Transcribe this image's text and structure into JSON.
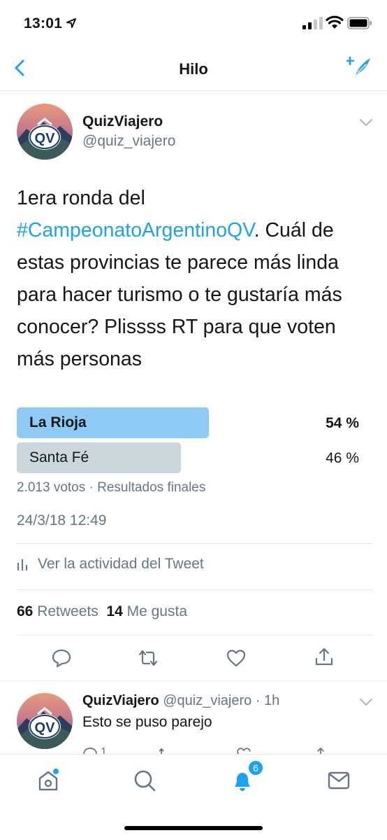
{
  "status_bar": {
    "time": "13:01"
  },
  "nav": {
    "title": "Hilo"
  },
  "tweet": {
    "author_name": "QuizViajero",
    "author_handle": "@quiz_viajero",
    "avatar_text": "QV",
    "text_before": "1era ronda del ",
    "hashtag": "#CampeonatoArgentinoQV",
    "text_after": ". Cuál de estas provincias te parece más linda para hacer turismo o te gustaría más conocer? Plissss RT para que voten más personas",
    "poll": {
      "options": [
        {
          "label": "La Rioja",
          "percent_label": "54 %",
          "percent": 54,
          "winner": true,
          "color": "#8fcaf5"
        },
        {
          "label": "Santa Fé",
          "percent_label": "46 %",
          "percent": 46,
          "winner": false,
          "color": "#ccd6dd"
        }
      ],
      "meta": "2.013 votos · Resultados finales"
    },
    "date": "24/3/18 12:49",
    "activity_label": "Ver la actividad del Tweet",
    "stats": {
      "retweets_count": "66",
      "retweets_label": "Retweets",
      "likes_count": "14",
      "likes_label": "Me gusta"
    }
  },
  "reply": {
    "author_name": "QuizViajero",
    "author_handle": "@quiz_viajero",
    "time": "· 1h",
    "text": "Esto se puso parejo",
    "avatar_text": "QV",
    "reply_count": "1"
  },
  "tab_bar": {
    "notifications_badge": "6"
  },
  "colors": {
    "accent": "#1da1f2",
    "muted": "#657786",
    "text": "#14171a",
    "divider": "#e1e8ed"
  }
}
